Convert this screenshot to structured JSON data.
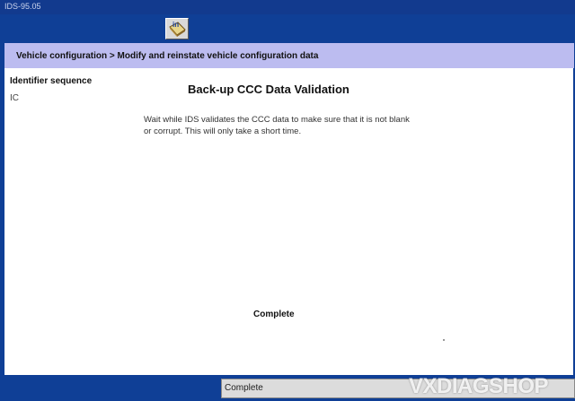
{
  "window": {
    "title": "IDS-95.05"
  },
  "toolbar": {
    "button_icon": "book-info-icon"
  },
  "breadcrumb": {
    "text": "Vehicle configuration > Modify and reinstate vehicle configuration data"
  },
  "sidebar": {
    "label": "Identifier sequence",
    "value": "IC"
  },
  "main": {
    "heading": "Back-up CCC Data Validation",
    "message": "Wait while IDS validates the CCC data to make sure that it is not blank or corrupt. This will only take a short time.",
    "result": "Complete"
  },
  "status": {
    "text": "Complete"
  },
  "watermark": {
    "text": "VXDIAGSHOP"
  }
}
